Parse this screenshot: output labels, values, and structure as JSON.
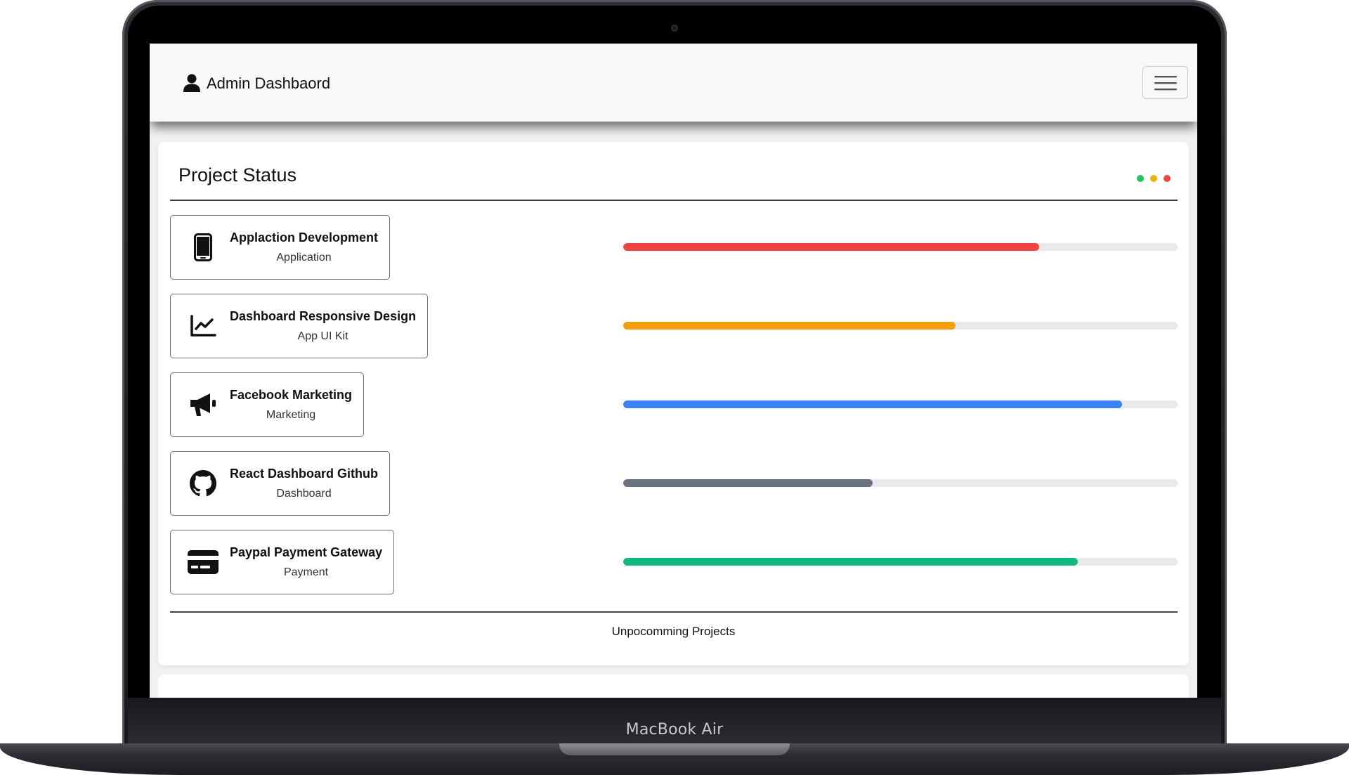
{
  "device": {
    "label": "MacBook Air"
  },
  "navbar": {
    "brand_icon": "user-icon",
    "title": "Admin Dashbaord",
    "menu_icon": "hamburger-menu-icon"
  },
  "project_status": {
    "title": "Project Status",
    "dots": [
      "#22c55e",
      "#eab308",
      "#ef4444"
    ],
    "footer_link": "Unpocomming Projects",
    "projects": [
      {
        "name": "Applaction Development",
        "category": "Application",
        "icon": "mobile-phone-icon",
        "progress": 0.75,
        "color": "#ef4444"
      },
      {
        "name": "Dashboard Responsive Design",
        "category": "App UI Kit",
        "icon": "line-chart-icon",
        "progress": 0.6,
        "color": "#f59e0b"
      },
      {
        "name": "Facebook Marketing",
        "category": "Marketing",
        "icon": "megaphone-icon",
        "progress": 0.9,
        "color": "#3b82f6"
      },
      {
        "name": "React Dashboard Github",
        "category": "Dashboard",
        "icon": "github-icon",
        "progress": 0.45,
        "color": "#6b7280"
      },
      {
        "name": "Paypal Payment Gateway",
        "category": "Payment",
        "icon": "credit-card-icon",
        "progress": 0.82,
        "color": "#10b981"
      }
    ]
  }
}
